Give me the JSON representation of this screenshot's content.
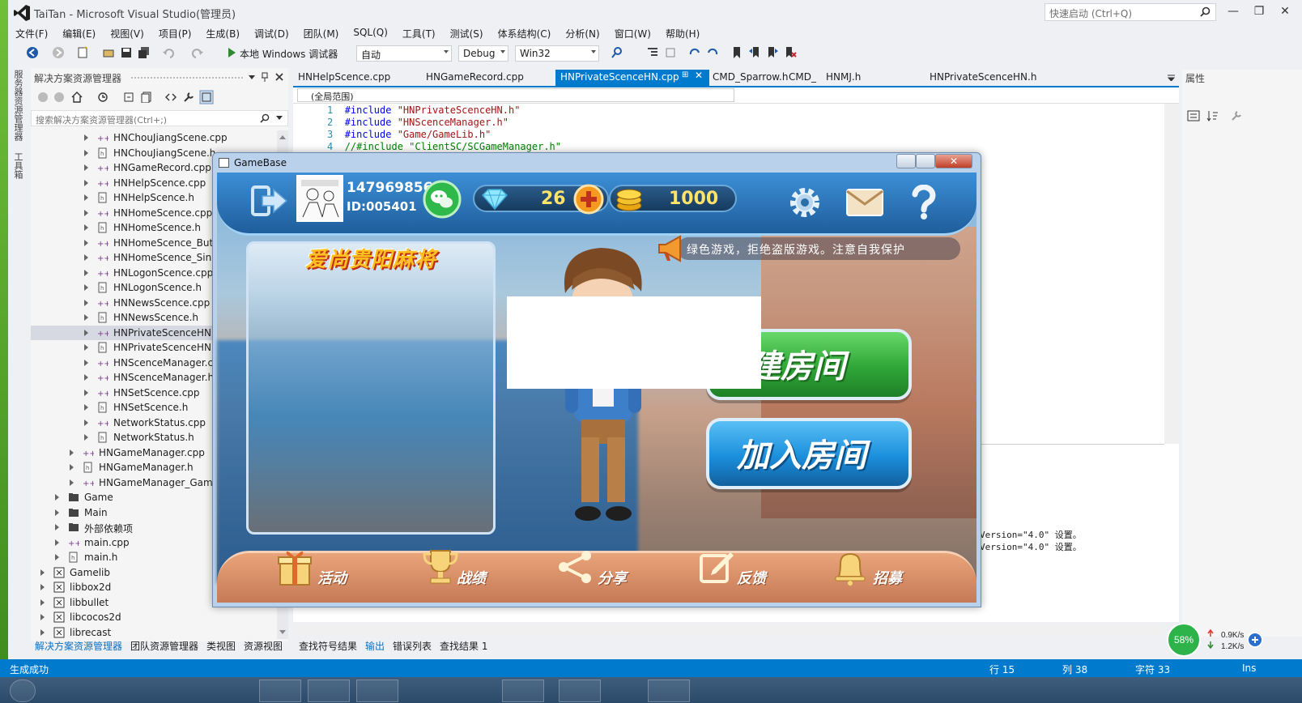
{
  "window": {
    "title": "TaiTan - Microsoft Visual Studio(管理员)",
    "quick_launch_placeholder": "快速启动 (Ctrl+Q)"
  },
  "menu": [
    "文件(F)",
    "编辑(E)",
    "视图(V)",
    "项目(P)",
    "生成(B)",
    "调试(D)",
    "团队(M)",
    "SQL(Q)",
    "工具(T)",
    "测试(S)",
    "体系结构(C)",
    "分析(N)",
    "窗口(W)",
    "帮助(H)"
  ],
  "toolbar": {
    "run_label": "本地 Windows 调试器",
    "auto_label": "自动",
    "config": "Debug",
    "platform": "Win32"
  },
  "side_tabs": [
    "服务器资源管理器",
    "工具箱"
  ],
  "solution_explorer": {
    "title": "解决方案资源管理器",
    "search_placeholder": "搜索解决方案资源管理器(Ctrl+;)",
    "items": [
      {
        "label": "HNChouJiangScene.cpp",
        "type": "cpp",
        "level": 3
      },
      {
        "label": "HNChouJiangScene.h",
        "type": "h",
        "level": 3
      },
      {
        "label": "HNGameRecord.cpp",
        "type": "cpp",
        "level": 3
      },
      {
        "label": "HNHelpScence.cpp",
        "type": "cpp",
        "level": 3
      },
      {
        "label": "HNHelpScence.h",
        "type": "h",
        "level": 3
      },
      {
        "label": "HNHomeScence.cpp",
        "type": "cpp",
        "level": 3
      },
      {
        "label": "HNHomeScence.h",
        "type": "h",
        "level": 3
      },
      {
        "label": "HNHomeScence_Butt",
        "type": "cpp",
        "level": 3
      },
      {
        "label": "HNHomeScence_Sink",
        "type": "cpp",
        "level": 3
      },
      {
        "label": "HNLogonScence.cpp",
        "type": "cpp",
        "level": 3
      },
      {
        "label": "HNLogonScence.h",
        "type": "h",
        "level": 3
      },
      {
        "label": "HNNewsScence.cpp",
        "type": "cpp",
        "level": 3
      },
      {
        "label": "HNNewsScence.h",
        "type": "h",
        "level": 3
      },
      {
        "label": "HNPrivateScenceHN.",
        "type": "cpp",
        "level": 3,
        "selected": true
      },
      {
        "label": "HNPrivateScenceHN.",
        "type": "h",
        "level": 3
      },
      {
        "label": "HNScenceManager.c",
        "type": "cpp",
        "level": 3
      },
      {
        "label": "HNScenceManager.h",
        "type": "cpp",
        "level": 3
      },
      {
        "label": "HNSetScence.cpp",
        "type": "cpp",
        "level": 3
      },
      {
        "label": "HNSetScence.h",
        "type": "h",
        "level": 3
      },
      {
        "label": "NetworkStatus.cpp",
        "type": "cpp",
        "level": 3
      },
      {
        "label": "NetworkStatus.h",
        "type": "h",
        "level": 3
      },
      {
        "label": "HNGameManager.cpp",
        "type": "cpp",
        "level": 2
      },
      {
        "label": "HNGameManager.h",
        "type": "h",
        "level": 2
      },
      {
        "label": "HNGameManager_Gam",
        "type": "cpp",
        "level": 2
      },
      {
        "label": "Game",
        "type": "folder",
        "level": 1
      },
      {
        "label": "Main",
        "type": "folder",
        "level": 1
      },
      {
        "label": "外部依赖项",
        "type": "folder",
        "level": 1
      },
      {
        "label": "main.cpp",
        "type": "cpp",
        "level": 1
      },
      {
        "label": "main.h",
        "type": "h",
        "level": 1
      },
      {
        "label": "Gamelib",
        "type": "project",
        "level": 0
      },
      {
        "label": "libbox2d",
        "type": "project",
        "level": 0
      },
      {
        "label": "libbullet",
        "type": "project",
        "level": 0
      },
      {
        "label": "libcocos2d",
        "type": "project",
        "level": 0
      },
      {
        "label": "librecast",
        "type": "project",
        "level": 0
      }
    ],
    "bottom_tabs": [
      "解决方案资源管理器",
      "团队资源管理器",
      "类视图",
      "资源视图"
    ]
  },
  "editor": {
    "tabs": [
      "HNHelpScence.cpp",
      "HNGameRecord.cpp",
      "HNPrivateScenceHN.cpp",
      "CMD_Sparrow.h",
      "HNMJ.h",
      "HNPrivateScenceHN.h"
    ],
    "active_tab": "HNPrivateScenceHN.cpp",
    "tab_5_prefix": "CMD_",
    "scope": "(全局范围)",
    "lines": [
      {
        "n": "1",
        "kw": "#include",
        "text": " \"HNPrivateScenceHN.h\""
      },
      {
        "n": "2",
        "kw": "#include",
        "text": " \"HNScenceManager.h\""
      },
      {
        "n": "3",
        "kw": "#include",
        "text": " \"Game/GameLib.h\""
      },
      {
        "n": "4",
        "kw": "",
        "text": "//#include \"ClientSC/SCGameManager.h\""
      }
    ],
    "output_lines": [
      "Version=\"4.0\" 设置。",
      "Version=\"4.0\" 设置。"
    ],
    "output_tabs": [
      "查找符号结果",
      "输出",
      "错误列表",
      "查找结果 1"
    ],
    "active_output_tab": "输出"
  },
  "properties": {
    "title": "属性"
  },
  "status": {
    "message": "生成成功",
    "line": "行 15",
    "col": "列 38",
    "char": "字符 33",
    "mode": "Ins"
  },
  "netmon": {
    "percent": "58%",
    "up": "0.9K/s",
    "down": "1.2K/s"
  },
  "game_window": {
    "title": "GameBase",
    "user_id_top": "1479698563",
    "user_id": "ID:005401",
    "diamonds": "26",
    "coins": "1000",
    "notice": "绿色游戏，拒绝盗版游戏。注意自我保护",
    "card_title": "爱尚贵阳麻将",
    "create_room": "创建房间",
    "join_room": "加入房间",
    "bottom_menu": [
      "活动",
      "战绩",
      "分享",
      "反馈",
      "招募"
    ]
  },
  "colors": {
    "vs_blue": "#007acc",
    "selection": "#d6d8e2",
    "create_btn": "#33b83a",
    "join_btn": "#1b8fdc"
  }
}
